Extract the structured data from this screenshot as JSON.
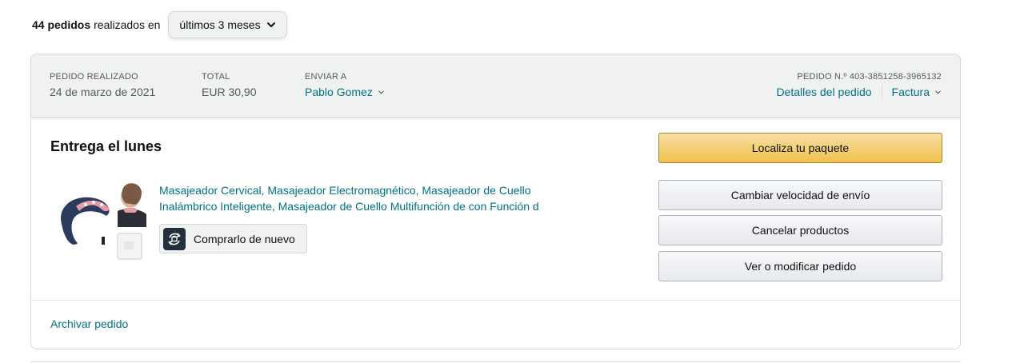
{
  "filter": {
    "count": "44 pedidos",
    "text": "realizados en",
    "period": "últimos 3 meses"
  },
  "order": {
    "placed_label": "PEDIDO REALIZADO",
    "placed_date": "24 de marzo de 2021",
    "total_label": "TOTAL",
    "total_value": "EUR 30,90",
    "ship_to_label": "ENVIAR A",
    "ship_to_name": "Pablo Gomez",
    "order_number_label": "PEDIDO N.º 403-3851258-3965132",
    "details_link": "Detalles del pedido",
    "invoice_link": "Factura",
    "delivery_status": "Entrega el lunes",
    "product": {
      "title_line1": "Masajeador Cervical, Masajeador Electromagnético, Masajeador de Cuello",
      "title_line2": "Inalámbrico Inteligente, Masajeador de Cuello Multifunción de con Función d",
      "buy_again_label": "Comprarlo de nuevo"
    },
    "actions": {
      "track": "Localiza tu paquete",
      "change_speed": "Cambiar velocidad de envío",
      "cancel": "Cancelar productos",
      "view_modify": "Ver o modificar pedido"
    },
    "archive_link": "Archivar pedido"
  },
  "colors": {
    "link": "#007185",
    "primary_button": "#f0c14b",
    "header_bg": "#f0f2f2"
  }
}
